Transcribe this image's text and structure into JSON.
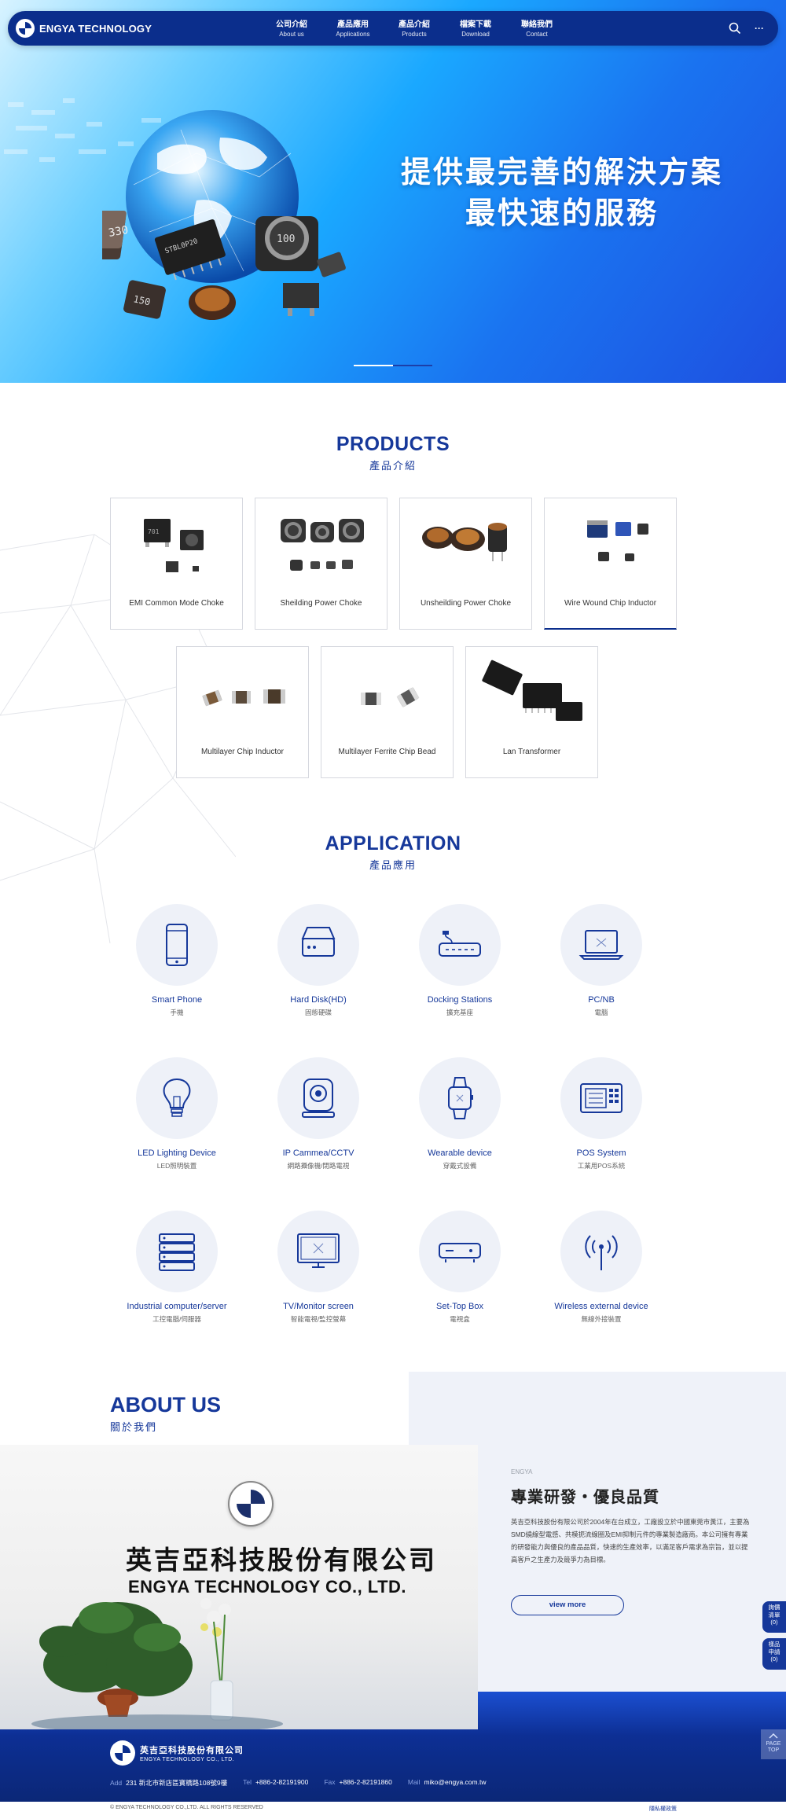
{
  "brand": {
    "name": "ENGYA TECHNOLOGY"
  },
  "nav": {
    "items": [
      {
        "zh": "公司介紹",
        "en": "About us"
      },
      {
        "zh": "產品應用",
        "en": "Applications"
      },
      {
        "zh": "產品介紹",
        "en": "Products"
      },
      {
        "zh": "檔案下載",
        "en": "Download"
      },
      {
        "zh": "聯絡我們",
        "en": "Contact"
      }
    ],
    "more_label": "···"
  },
  "hero": {
    "line1": "提供最完善的解決方案",
    "line2": "最快速的服務",
    "slides_count": 2,
    "active_slide": 1,
    "chip_labels": [
      "330",
      "100",
      "150",
      "STBL0P20"
    ]
  },
  "products": {
    "title_en": "PRODUCTS",
    "title_zh": "產品介紹",
    "items": [
      {
        "name": "EMI Common Mode Choke"
      },
      {
        "name": "Sheilding Power Choke"
      },
      {
        "name": "Unsheilding Power Choke"
      },
      {
        "name": "Wire Wound Chip Inductor"
      },
      {
        "name": "Multilayer Chip Inductor"
      },
      {
        "name": "Multilayer Ferrite Chip Bead"
      },
      {
        "name": "Lan Transformer"
      }
    ]
  },
  "applications": {
    "title_en": "APPLICATION",
    "title_zh": "產品應用",
    "items": [
      {
        "en": "Smart Phone",
        "zh": "手機",
        "icon": "smartphone-icon"
      },
      {
        "en": "Hard Disk(HD)",
        "zh": "固態硬碟",
        "icon": "hard-disk-icon"
      },
      {
        "en": "Docking Stations",
        "zh": "擴充基座",
        "icon": "docking-station-icon"
      },
      {
        "en": "PC/NB",
        "zh": "電腦",
        "icon": "laptop-icon"
      },
      {
        "en": "LED Lighting Device",
        "zh": "LED照明裝置",
        "icon": "lightbulb-icon"
      },
      {
        "en": "IP Cammea/CCTV",
        "zh": "網路攝像機/閉路電視",
        "icon": "ip-camera-icon"
      },
      {
        "en": "Wearable device",
        "zh": "穿戴式設備",
        "icon": "smartwatch-icon"
      },
      {
        "en": "POS System",
        "zh": "工業用POS系統",
        "icon": "pos-terminal-icon"
      },
      {
        "en": "Industrial computer/server",
        "zh": "工控電腦/伺服器",
        "icon": "server-icon"
      },
      {
        "en": "TV/Monitor screen",
        "zh": "智能電視/監控螢幕",
        "icon": "tv-monitor-icon"
      },
      {
        "en": "Set-Top Box",
        "zh": "電視盒",
        "icon": "set-top-box-icon"
      },
      {
        "en": "Wireless external device",
        "zh": "無線外接裝置",
        "icon": "wireless-antenna-icon"
      }
    ]
  },
  "about": {
    "title_en": "ABOUT US",
    "title_zh": "關於我們",
    "eyebrow": "ENGYA",
    "heading": "專業研發・優良品質",
    "body": "英吉亞科技股份有限公司於2004年在台成立，工廠設立於中國東莞市黃江，主要為SMD繞線型電感、共模扼流線圈及EMI抑制元件的專業製造廠商。本公司擁有專業的研發能力與優良的產品品質，快速的生產效率，以滿足客戶需求為宗旨，並以提高客戶之生產力及競爭力為目標。",
    "button": "view more",
    "photo_zh": "英吉亞科技股份有限公司",
    "photo_en": "ENGYA TECHNOLOGY CO., LTD.",
    "photo_logo_text": "ENGYA"
  },
  "side_tabs": [
    {
      "line1": "詢價",
      "line2": "清單",
      "count": "(0)"
    },
    {
      "line1": "樣品",
      "line2": "申請",
      "count": "(0)"
    }
  ],
  "page_top": {
    "line1": "PAGE",
    "line2": "TOP"
  },
  "footer": {
    "company_zh": "英吉亞科技股份有限公司",
    "company_en": "ENGYA TECHNOLOGY CO., LTD.",
    "add_label": "Add",
    "address": "231 新北市新店區寶橋路108號9樓",
    "tel_label": "Tel",
    "tel": "+886-2-82191900",
    "fax_label": "Fax",
    "fax": "+886-2-82191860",
    "mail_label": "Mail",
    "mail": "miko@engya.com.tw",
    "copyright": "© ENGYA TECHNOLOGY CO.,LTD. ALL RIGHTS RESERVED",
    "privacy": "隱私權政策"
  },
  "colors": {
    "primary": "#0b2e8c",
    "accent": "#16389a",
    "band": "#eff2f9"
  }
}
